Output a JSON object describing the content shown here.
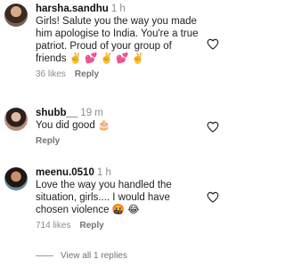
{
  "comments": [
    {
      "username": "harsha.sandhu",
      "time": "1 h",
      "text": "Girls! Salute you the way you made him apologise to India. You're a true patriot. Proud of your group of friends ✌️ 💕 ✌️ 💕 ✌️",
      "likes": "36 likes",
      "reply": "Reply"
    },
    {
      "username": "shubb__",
      "time": "19 m",
      "text": "You did good 🎂",
      "likes": "",
      "reply": "Reply"
    },
    {
      "username": "meenu.0510",
      "time": "1 h",
      "text": "Love the way you handled the situation, girls.... I would have chosen violence 🤬 😂",
      "likes": "714 likes",
      "reply": "Reply"
    }
  ],
  "view_replies": "View all 1 replies",
  "icons": {
    "like": "heart-outline-icon"
  },
  "colors": {
    "muted": "#8e8e8e",
    "text": "#111111"
  }
}
